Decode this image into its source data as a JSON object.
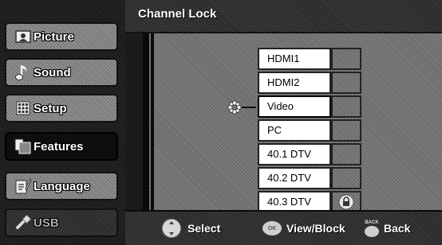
{
  "sidebar": {
    "items": [
      {
        "label": "Picture",
        "icon": "picture-icon",
        "state": "normal"
      },
      {
        "label": "Sound",
        "icon": "music-note-icon",
        "state": "normal"
      },
      {
        "label": "Setup",
        "icon": "setup-grid-icon",
        "state": "normal"
      },
      {
        "label": "Features",
        "icon": "features-icon",
        "state": "active"
      },
      {
        "label": "Language",
        "icon": "language-icon",
        "state": "normal"
      },
      {
        "label": "USB",
        "icon": "usb-icon",
        "state": "dimmed"
      }
    ]
  },
  "header": {
    "title": "Channel Lock"
  },
  "channels": [
    {
      "name": "HDMI1",
      "locked": false
    },
    {
      "name": "HDMI2",
      "locked": false
    },
    {
      "name": "Video",
      "locked": false,
      "selected": true
    },
    {
      "name": "PC",
      "locked": false
    },
    {
      "name": "40.1 DTV",
      "locked": false
    },
    {
      "name": "40.2 DTV",
      "locked": false
    },
    {
      "name": "40.3 DTV",
      "locked": true
    }
  ],
  "footer": {
    "select_label": "Select",
    "ok_button_text": "OK",
    "view_block_label": "View/Block",
    "back_button_text": "BACK",
    "back_label": "Back"
  },
  "colors": {
    "background": "#1b1b1b",
    "menu_item": "#7a7a7a",
    "menu_item_active": "#0e0e0e",
    "cell": "#ffffff",
    "lock_cell": "#6a6a6a"
  }
}
